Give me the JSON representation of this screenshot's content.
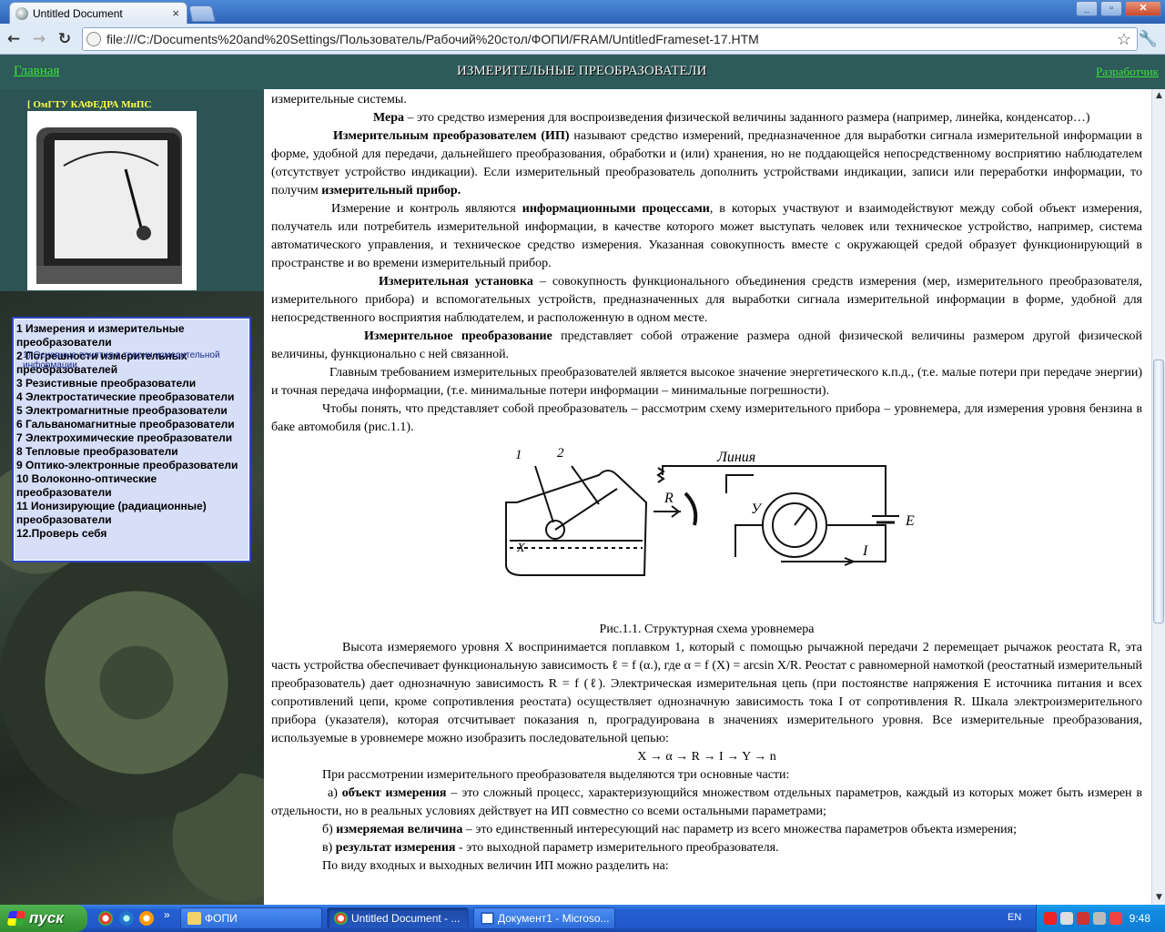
{
  "browser": {
    "tab_title": "Untitled Document",
    "tab_close": "×",
    "url": "file:///C:/Documents%20and%20Settings/Пользователь/Рабочий%20стол/ФОПИ/FRAM/UntitledFrameset-17.HTM",
    "win_min": "_",
    "win_max": "▫",
    "win_close": "✕",
    "back": "←",
    "forward": "→",
    "reload": "↻",
    "star": "☆",
    "wrench": "🔧"
  },
  "header": {
    "home_link": "Главная",
    "title": "ИЗМЕРИТЕЛЬНЫЕ ПРЕОБРАЗОВАТЕЛИ",
    "dev_link": "Разработчик"
  },
  "sidebar": {
    "dept": "[ ОмГТУ КАФЕДРА МиПС",
    "toc_sub": "1) Основные понятия в теории измерительной информации",
    "toc": [
      "1 Измерения и измерительные\nпреобразователи",
      "2 Погрешности измерительных\nпреобразователей",
      "3 Резистивные преобразователи",
      "4 Электростатические преобразователи",
      "5 Электромагнитные преобразователи",
      "6 Гальваномагнитные преобразователи",
      "7 Электрохимические преобразователи",
      "8 Тепловые преобразователи",
      "9 Оптико-электронные преобразователи",
      "10 Волоконно-оптические\nпреобразователи",
      "11 Ионизирующие (радиационные)\nпреобразователи",
      "12.Проверь себя"
    ]
  },
  "content": {
    "p0": "измерительные системы.",
    "p1_b": "Мера",
    "p1": " – это средство измерения для воспроизведения физической величины заданного размера (например, линейка, конденсатор…)",
    "p2_b": "Измерительным преобразователем (ИП)",
    "p2": " называют средство измерений,   предназначенное   для   выработки   сигнала   измерительной информации в форме, удобной для   передачи,   дальнейшего   преобразования, обработки и (или) хранения, но не поддающейся непосредственному восприятию наблюдателем (отсутствует устройство индикации). Если измерительный преобразователь дополнить устройствами индикации, записи или переработки информации, то получим ",
    "p2_b2": "измерительный прибор.",
    "p3a": "Измерение и контроль являются ",
    "p3_b": "информационными процессами",
    "p3": ", в которых участвуют и взаимодействуют между собой объект измерения, получатель или потребитель измерительной информации, в качестве которого может выступать человек или техническое устройство, например, система автоматического управления, и техническое средство измерения. Указанная совокупность вместе с окружающей средой образует функционирующий в пространстве и во времени измерительный прибор.",
    "p4_b": "Измерительная установка",
    "p4": " – совокупность функционального объединения средств измерения (мер, измерительного преобразователя, измерительного прибора) и вспомогательных устройств, предназначенных для выработки сигнала измерительной информации в форме, удобной для непосредственного восприятия наблюдателем, и расположенную в одном месте.",
    "p5_b": "Измерительное преобразование",
    "p5": " представляет собой отражение размера одной физической величины размером другой физической величины, функционально с ней связанной.",
    "p6": "Главным требованием измерительных   преобразователей  является  высокое значение энергетического к.п.д., (т.е. малые потери при передаче энергии) и точная передача информации, (т.е. минимальные потери информации – минимальные  погрешности).",
    "p7": "Чтобы понять, что представляет собой преобразователь – рассмотрим схему измерительного прибора – уровнемера,  для измерения уровня бензина в баке автомобиля (рис.1.1).",
    "fig_labels": {
      "n1": "1",
      "n2": "2",
      "line": "Линия",
      "r": "R",
      "y": "У",
      "e": "E",
      "i": "I",
      "x": "X"
    },
    "caption": "Рис.1.1. Структурная схема уровнемера",
    "p8": "Высота измеряемого уровня X воспринимается поплавком 1,  который с помощью  рычажной   передачи  2   перемещает рычажок реостата R,  эта часть устройства обеспечивает  функциональную зависимость ℓ = f (α.),  где α = f (X) = arcsin X/R.  Реостат с равномерной намоткой (реостатный измерительный преобразователь) дает однозначную  зависимость  R = f (ℓ). Электрическая измерительная цепь (при постоянстве  напряжения E источника питания и всех сопротивлений цепи, кроме сопротивления реостата) осуществляет однозначную зависимость тока  I от сопротивления  R.      Шкала электроизмерительного прибора (указателя),  которая отсчитывает показания n, проградуирована в значениях измерительного уровня. Все измерительные преобразования, используемые в уровнемере можно изобразить  последовательной цепью:",
    "chain": "X → α → R → I → Y → n",
    "p9": "При рассмотрении измерительного преобразователя выделяются три основные части:",
    "p10a": "а) ",
    "p10_b": "объект измерения",
    "p10": " – это сложный процесс, характеризующийся множеством отдельных параметров, каждый из которых может быть измерен  в отдельности, но в реальных условиях действует на ИП совместно со всеми остальными параметрами;",
    "p11a": "б) ",
    "p11_b": "измеряемая величина",
    "p11": " – это единственный интересующий нас параметр из всего множества параметров объекта измерения;",
    "p12a": "в) ",
    "p12_b": "результат измерения",
    "p12": " -  это выходной параметр измерительного преобразователя.",
    "p13": "По виду входных и выходных величин ИП можно разделить на:"
  },
  "scrollbar": {
    "up": "▲",
    "down": "▼"
  },
  "taskbar": {
    "start": "пуск",
    "more": "»",
    "tasks": [
      "ФОПИ",
      "Untitled Document - ...",
      "Документ1 - Microso..."
    ],
    "lang": "EN",
    "clock": "9:48"
  }
}
